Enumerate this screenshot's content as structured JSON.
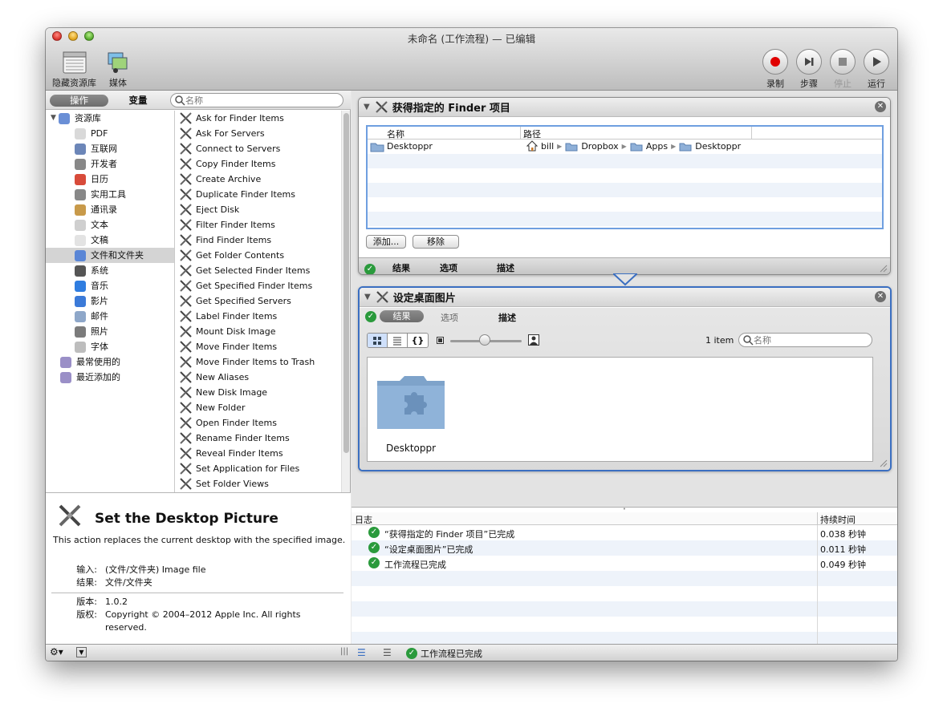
{
  "window": {
    "title": "未命名 (工作流程) — 已编辑"
  },
  "toolbar": {
    "hide_library": "隐藏资源库",
    "media": "媒体",
    "record": "录制",
    "step": "步骤",
    "stop": "停止",
    "run": "运行"
  },
  "left": {
    "tabs": {
      "actions": "操作",
      "variables": "变量"
    },
    "search_placeholder": "名称",
    "library": [
      {
        "label": "资源库",
        "icon": "library-icon",
        "color": "#6a8fd6",
        "level": 0
      },
      {
        "label": "PDF",
        "icon": "pdf-icon",
        "color": "#d9d9d9",
        "level": 1
      },
      {
        "label": "互联网",
        "icon": "globe-icon",
        "color": "#6c86b8",
        "level": 1
      },
      {
        "label": "开发者",
        "icon": "tools-icon",
        "color": "#888888",
        "level": 1
      },
      {
        "label": "日历",
        "icon": "calendar-icon",
        "color": "#d84b3a",
        "level": 1
      },
      {
        "label": "实用工具",
        "icon": "utility-icon",
        "color": "#888888",
        "level": 1
      },
      {
        "label": "通讯录",
        "icon": "contacts-icon",
        "color": "#c89a4a",
        "level": 1
      },
      {
        "label": "文本",
        "icon": "text-icon",
        "color": "#cfcfcf",
        "level": 1
      },
      {
        "label": "文稿",
        "icon": "document-icon",
        "color": "#e3e3e3",
        "level": 1
      },
      {
        "label": "文件和文件夹",
        "icon": "finder-icon",
        "color": "#5a86d6",
        "level": 1,
        "selected": true
      },
      {
        "label": "系统",
        "icon": "system-icon",
        "color": "#555555",
        "level": 1
      },
      {
        "label": "音乐",
        "icon": "music-icon",
        "color": "#2f7de0",
        "level": 1
      },
      {
        "label": "影片",
        "icon": "movie-icon",
        "color": "#3b7ad8",
        "level": 1
      },
      {
        "label": "邮件",
        "icon": "mail-icon",
        "color": "#8ea7c9",
        "level": 1
      },
      {
        "label": "照片",
        "icon": "photo-icon",
        "color": "#7b7b7b",
        "level": 1
      },
      {
        "label": "字体",
        "icon": "font-icon",
        "color": "#bdbdbd",
        "level": 1
      },
      {
        "label": "最常使用的",
        "icon": "smart-folder-icon",
        "color": "#9a8fc7",
        "level": 0
      },
      {
        "label": "最近添加的",
        "icon": "smart-folder-icon",
        "color": "#9a8fc7",
        "level": 0
      }
    ],
    "actions": [
      "Ask for Finder Items",
      "Ask For Servers",
      "Connect to Servers",
      "Copy Finder Items",
      "Create Archive",
      "Duplicate Finder Items",
      "Eject Disk",
      "Filter Finder Items",
      "Find Finder Items",
      "Get Folder Contents",
      "Get Selected Finder Items",
      "Get Specified Finder Items",
      "Get Specified Servers",
      "Label Finder Items",
      "Mount Disk Image",
      "Move Finder Items",
      "Move Finder Items to Trash",
      "New Aliases",
      "New Disk Image",
      "New Folder",
      "Open Finder Items",
      "Rename Finder Items",
      "Reveal Finder Items",
      "Set Application for Files",
      "Set Folder Views"
    ],
    "description": {
      "title": "Set the Desktop Picture",
      "text": "This action replaces the current desktop with the specified image.",
      "input_label": "输入:",
      "input_value": "(文件/文件夹) Image file",
      "result_label": "结果:",
      "result_value": "文件/文件夹",
      "version_label": "版本:",
      "version_value": "1.0.2",
      "copyright_label": "版权:",
      "copyright_value_1": "Copyright © 2004–2012 Apple Inc.  All rights",
      "copyright_value_2": "reserved."
    }
  },
  "workflow": {
    "action1": {
      "title": "获得指定的 Finder 项目",
      "col_name": "名称",
      "col_path": "路径",
      "row_name": "Desktoppr",
      "path": [
        "bill",
        "Dropbox",
        "Apps",
        "Desktoppr"
      ],
      "add_button": "添加...",
      "remove_button": "移除",
      "footer": {
        "results": "结果",
        "options": "选项",
        "description": "描述"
      }
    },
    "action2": {
      "title": "设定桌面图片",
      "tabs": {
        "results": "结果",
        "options": "选项",
        "description": "描述"
      },
      "item_count": "1 item",
      "search_placeholder": "名称",
      "item_label": "Desktoppr"
    }
  },
  "log": {
    "col_log": "日志",
    "col_duration": "持续时间",
    "rows": [
      {
        "text": "“获得指定的 Finder 项目”已完成",
        "duration": "0.038 秒钟"
      },
      {
        "text": "“设定桌面图片”已完成",
        "duration": "0.011 秒钟"
      },
      {
        "text": "工作流程已完成",
        "duration": "0.049 秒钟"
      }
    ]
  },
  "status": {
    "text": "工作流程已完成"
  }
}
